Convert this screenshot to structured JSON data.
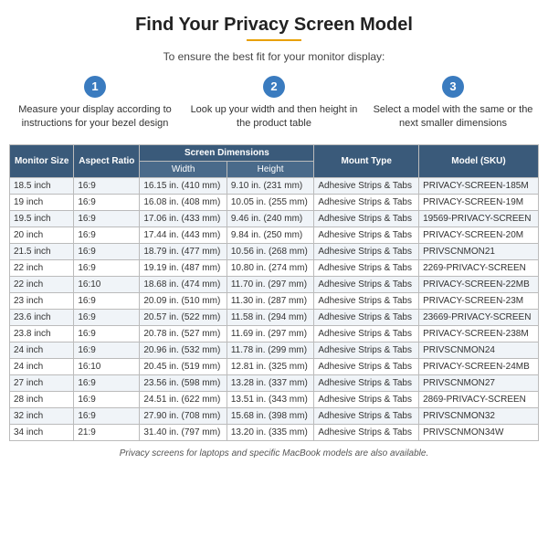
{
  "header": {
    "title": "Find Your Privacy Screen Model",
    "subtitle": "To ensure the best fit for your monitor display:"
  },
  "steps": [
    {
      "number": "1",
      "text": "Measure your display according to instructions for your bezel design"
    },
    {
      "number": "2",
      "text": "Look up your width and then height in the product table"
    },
    {
      "number": "3",
      "text": "Select a model with the same or the next smaller dimensions"
    }
  ],
  "table": {
    "headers": {
      "monitor_size": "Monitor Size",
      "aspect_ratio": "Aspect Ratio",
      "screen_dimensions": "Screen Dimensions",
      "width": "Width",
      "height": "Height",
      "mount_type": "Mount Type",
      "model_sku": "Model (SKU)"
    },
    "rows": [
      {
        "size": "18.5 inch",
        "ratio": "16:9",
        "width": "16.15 in. (410 mm)",
        "height": "9.10 in. (231 mm)",
        "mount": "Adhesive Strips & Tabs",
        "model": "PRIVACY-SCREEN-185M"
      },
      {
        "size": "19 inch",
        "ratio": "16:9",
        "width": "16.08 in. (408 mm)",
        "height": "10.05 in. (255 mm)",
        "mount": "Adhesive Strips & Tabs",
        "model": "PRIVACY-SCREEN-19M"
      },
      {
        "size": "19.5 inch",
        "ratio": "16:9",
        "width": "17.06 in. (433 mm)",
        "height": "9.46 in. (240 mm)",
        "mount": "Adhesive Strips & Tabs",
        "model": "19569-PRIVACY-SCREEN"
      },
      {
        "size": "20 inch",
        "ratio": "16:9",
        "width": "17.44 in. (443 mm)",
        "height": "9.84 in. (250 mm)",
        "mount": "Adhesive Strips & Tabs",
        "model": "PRIVACY-SCREEN-20M"
      },
      {
        "size": "21.5 inch",
        "ratio": "16:9",
        "width": "18.79 in. (477 mm)",
        "height": "10.56 in. (268 mm)",
        "mount": "Adhesive Strips & Tabs",
        "model": "PRIVSCNMON21"
      },
      {
        "size": "22 inch",
        "ratio": "16:9",
        "width": "19.19 in. (487 mm)",
        "height": "10.80 in. (274 mm)",
        "mount": "Adhesive Strips & Tabs",
        "model": "2269-PRIVACY-SCREEN"
      },
      {
        "size": "22 inch",
        "ratio": "16:10",
        "width": "18.68 in. (474 mm)",
        "height": "11.70 in. (297 mm)",
        "mount": "Adhesive Strips & Tabs",
        "model": "PRIVACY-SCREEN-22MB"
      },
      {
        "size": "23 inch",
        "ratio": "16:9",
        "width": "20.09 in. (510 mm)",
        "height": "11.30 in. (287 mm)",
        "mount": "Adhesive Strips & Tabs",
        "model": "PRIVACY-SCREEN-23M"
      },
      {
        "size": "23.6 inch",
        "ratio": "16:9",
        "width": "20.57 in. (522 mm)",
        "height": "11.58 in. (294 mm)",
        "mount": "Adhesive Strips & Tabs",
        "model": "23669-PRIVACY-SCREEN"
      },
      {
        "size": "23.8 inch",
        "ratio": "16:9",
        "width": "20.78 in. (527 mm)",
        "height": "11.69 in. (297 mm)",
        "mount": "Adhesive Strips & Tabs",
        "model": "PRIVACY-SCREEN-238M"
      },
      {
        "size": "24 inch",
        "ratio": "16:9",
        "width": "20.96 in. (532 mm)",
        "height": "11.78 in. (299 mm)",
        "mount": "Adhesive Strips & Tabs",
        "model": "PRIVSCNMON24"
      },
      {
        "size": "24 inch",
        "ratio": "16:10",
        "width": "20.45 in. (519 mm)",
        "height": "12.81 in. (325 mm)",
        "mount": "Adhesive Strips & Tabs",
        "model": "PRIVACY-SCREEN-24MB"
      },
      {
        "size": "27 inch",
        "ratio": "16:9",
        "width": "23.56 in. (598 mm)",
        "height": "13.28 in. (337 mm)",
        "mount": "Adhesive Strips & Tabs",
        "model": "PRIVSCNMON27"
      },
      {
        "size": "28 inch",
        "ratio": "16:9",
        "width": "24.51 in. (622 mm)",
        "height": "13.51 in. (343 mm)",
        "mount": "Adhesive Strips & Tabs",
        "model": "2869-PRIVACY-SCREEN"
      },
      {
        "size": "32 inch",
        "ratio": "16:9",
        "width": "27.90 in. (708 mm)",
        "height": "15.68 in. (398 mm)",
        "mount": "Adhesive Strips & Tabs",
        "model": "PRIVSCNMON32"
      },
      {
        "size": "34 inch",
        "ratio": "21:9",
        "width": "31.40 in. (797 mm)",
        "height": "13.20 in. (335 mm)",
        "mount": "Adhesive Strips & Tabs",
        "model": "PRIVSCNMON34W"
      }
    ]
  },
  "footer": "Privacy screens for laptops and specific MacBook models are also available."
}
